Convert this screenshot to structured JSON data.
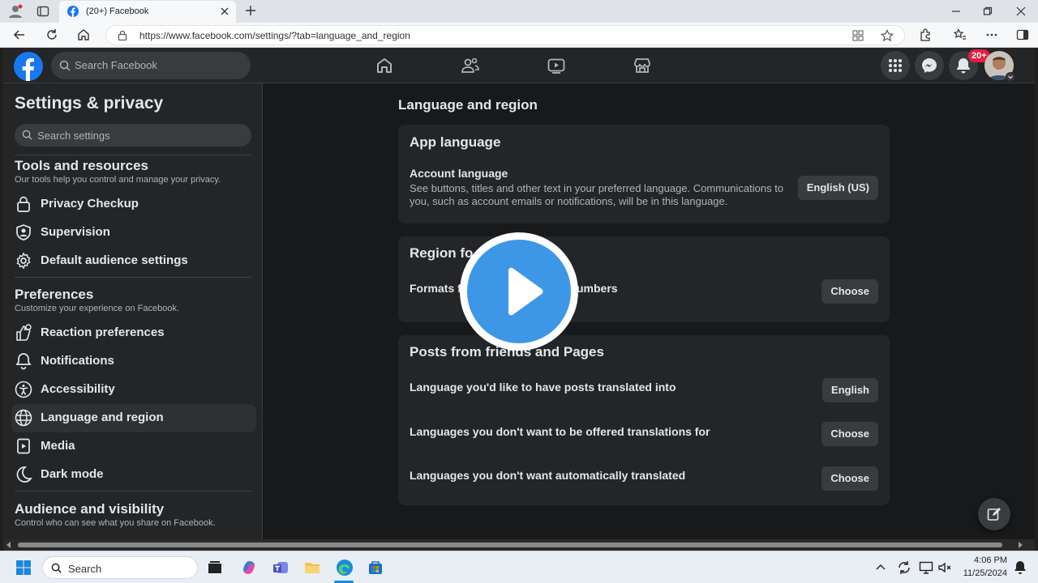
{
  "browser": {
    "tab_title": "(20+) Facebook",
    "url": "https://www.facebook.com/settings/?tab=language_and_region"
  },
  "fb": {
    "search_placeholder": "Search Facebook",
    "notification_badge": "20+"
  },
  "sidebar": {
    "title": "Settings & privacy",
    "search_placeholder": "Search settings",
    "tools": {
      "title": "Tools and resources",
      "subtitle": "Our tools help you control and manage your privacy.",
      "items": [
        "Privacy Checkup",
        "Supervision",
        "Default audience settings"
      ]
    },
    "preferences": {
      "title": "Preferences",
      "subtitle": "Customize your experience on Facebook.",
      "items": [
        "Reaction preferences",
        "Notifications",
        "Accessibility",
        "Language and region",
        "Media",
        "Dark mode"
      ]
    },
    "audience": {
      "title": "Audience and visibility",
      "subtitle": "Control who can see what you share on Facebook."
    }
  },
  "main": {
    "page_title": "Language and region",
    "app_language": {
      "title": "App language",
      "row_title": "Account language",
      "row_desc": "See buttons, titles and other text in your preferred language. Communications to you, such as account emails or notifications, will be in this language.",
      "button": "English (US)"
    },
    "region": {
      "title_visible": "Region fo",
      "row_left": "Formats f",
      "row_right": "umbers",
      "button": "Choose"
    },
    "posts": {
      "title": "Posts from friends and Pages",
      "rows": [
        {
          "label": "Language you'd like to have posts translated into",
          "button": "English"
        },
        {
          "label": "Languages you don't want to be offered translations for",
          "button": "Choose"
        },
        {
          "label": "Languages you don't want automatically translated",
          "button": "Choose"
        }
      ]
    }
  },
  "taskbar": {
    "search_label": "Search",
    "time": "4:06 PM",
    "date": "11/25/2024"
  },
  "colors": {
    "fb_blue": "#1877f2",
    "badge_red": "#e41e3f",
    "play_blue": "#3d97e6"
  }
}
